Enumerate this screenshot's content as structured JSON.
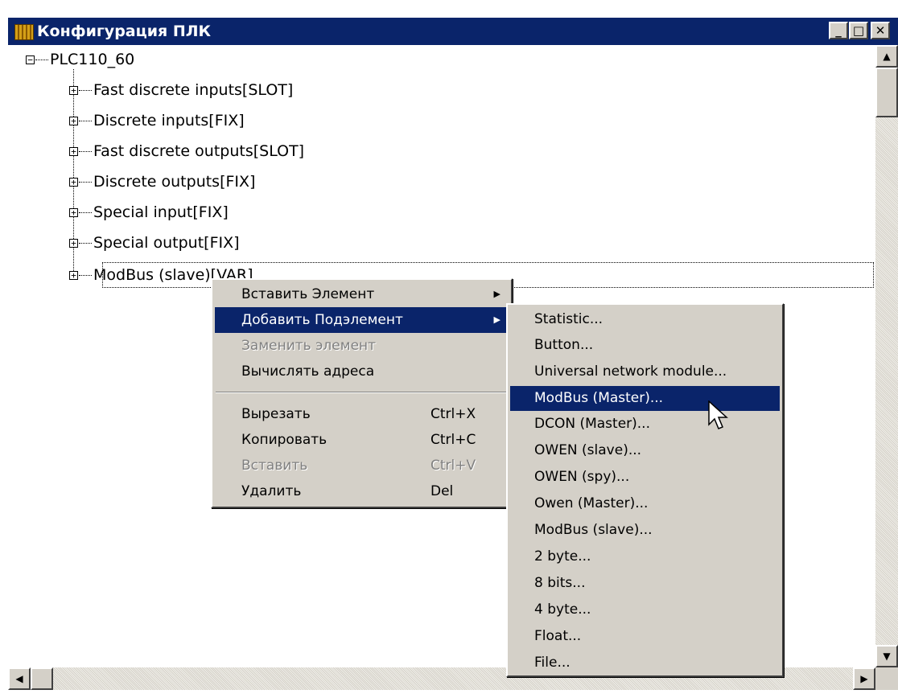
{
  "window": {
    "title": "Конфигурация ПЛК",
    "minimize": "_",
    "maximize": "□",
    "close": "✕"
  },
  "tree": {
    "root": {
      "expander": "−",
      "label": "PLC110_60"
    },
    "children": [
      {
        "expander": "+",
        "label": "Fast discrete inputs[SLOT]"
      },
      {
        "expander": "+",
        "label": "Discrete inputs[FIX]"
      },
      {
        "expander": "+",
        "label": "Fast discrete outputs[SLOT]"
      },
      {
        "expander": "+",
        "label": "Discrete outputs[FIX]"
      },
      {
        "expander": "+",
        "label": "Special input[FIX]"
      },
      {
        "expander": "+",
        "label": "Special output[FIX]"
      },
      {
        "expander": "+",
        "label": "ModBus (slave)[VAR]"
      }
    ]
  },
  "context_menu": {
    "items": [
      {
        "label": "Вставить Элемент",
        "shortcut": "",
        "arrow": "▶",
        "state": "normal"
      },
      {
        "label": "Добавить Подэлемент",
        "shortcut": "",
        "arrow": "▶",
        "state": "highlighted"
      },
      {
        "label": "Заменить элемент",
        "shortcut": "",
        "arrow": "",
        "state": "disabled"
      },
      {
        "label": "Вычислять адреса",
        "shortcut": "",
        "arrow": "",
        "state": "normal"
      },
      {
        "label": "Вырезать",
        "shortcut": "Ctrl+X",
        "arrow": "",
        "state": "normal"
      },
      {
        "label": "Копировать",
        "shortcut": "Ctrl+C",
        "arrow": "",
        "state": "normal"
      },
      {
        "label": "Вставить",
        "shortcut": "Ctrl+V",
        "arrow": "",
        "state": "disabled"
      },
      {
        "label": "Удалить",
        "shortcut": "Del",
        "arrow": "",
        "state": "normal"
      }
    ]
  },
  "submenu": {
    "items": [
      {
        "label": "Statistic...",
        "state": "normal"
      },
      {
        "label": "Button...",
        "state": "normal"
      },
      {
        "label": "Universal network module...",
        "state": "normal"
      },
      {
        "label": "ModBus (Master)...",
        "state": "highlighted"
      },
      {
        "label": "DCON (Master)...",
        "state": "normal"
      },
      {
        "label": "OWEN (slave)...",
        "state": "normal"
      },
      {
        "label": "OWEN (spy)...",
        "state": "normal"
      },
      {
        "label": "Owen (Master)...",
        "state": "normal"
      },
      {
        "label": "ModBus (slave)...",
        "state": "normal"
      },
      {
        "label": "2 byte...",
        "state": "normal"
      },
      {
        "label": "8 bits...",
        "state": "normal"
      },
      {
        "label": "4 byte...",
        "state": "normal"
      },
      {
        "label": "Float...",
        "state": "normal"
      },
      {
        "label": "File...",
        "state": "normal"
      }
    ]
  },
  "scrollbars": {
    "up": "▲",
    "down": "▼",
    "left": "◀",
    "right": "▶"
  },
  "colors": {
    "titlebar": "#0a246a",
    "menu_bg": "#d4d0c8",
    "highlight": "#0a246a",
    "disabled": "#808080"
  }
}
